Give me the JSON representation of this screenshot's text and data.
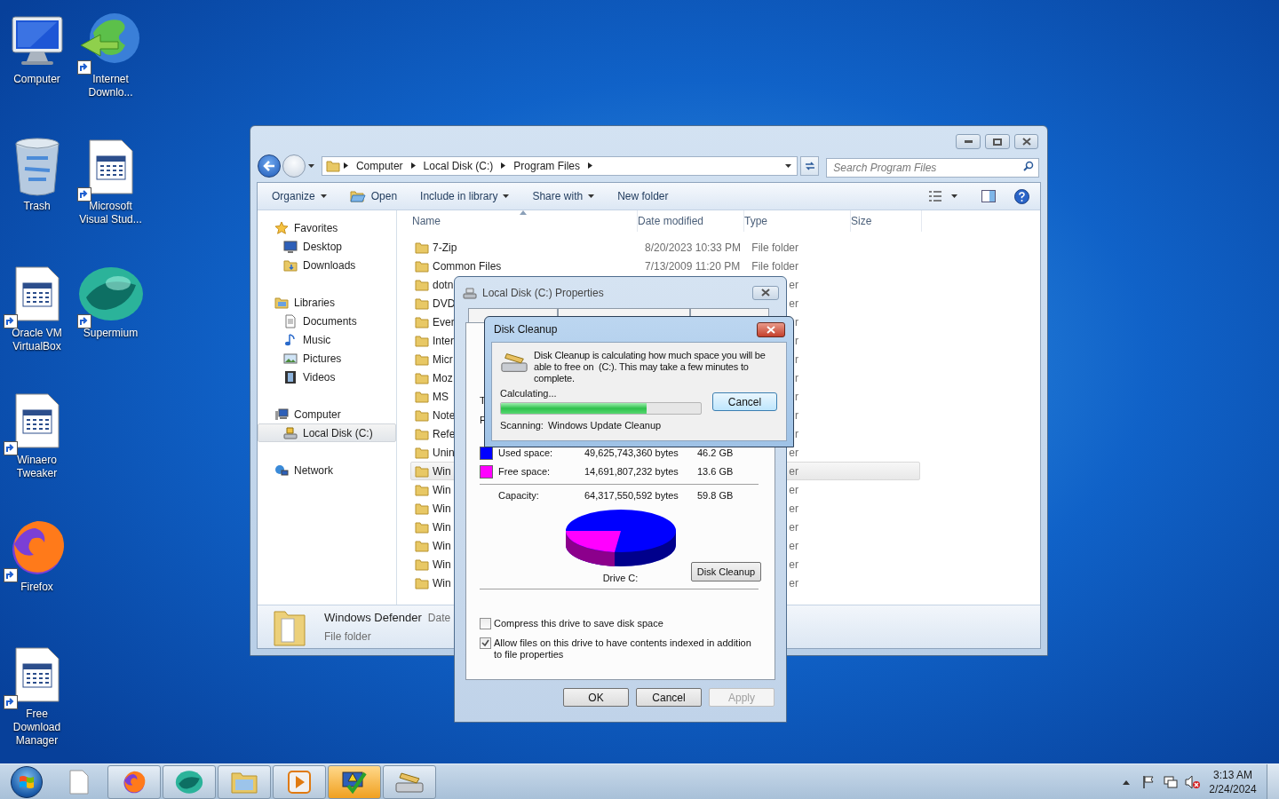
{
  "desktop_icons": [
    {
      "label": "Computer",
      "kind": "monitor",
      "shortcut": false
    },
    {
      "label": "Trash",
      "kind": "bin",
      "shortcut": false
    },
    {
      "label": "Oracle VM VirtualBox",
      "kind": "app",
      "shortcut": true
    },
    {
      "label": "Winaero Tweaker",
      "kind": "app",
      "shortcut": true
    },
    {
      "label": "Firefox",
      "kind": "fox",
      "shortcut": true
    },
    {
      "label": "Free Download Manager",
      "kind": "app",
      "shortcut": true
    },
    {
      "label": "Internet Downlo...",
      "kind": "globe",
      "shortcut": true
    },
    {
      "label": "Microsoft Visual Stud...",
      "kind": "app",
      "shortcut": true
    },
    {
      "label": "Supermium",
      "kind": "orb",
      "shortcut": true
    }
  ],
  "explorer": {
    "breadcrumb": [
      "Computer",
      "Local Disk (C:)",
      "Program Files"
    ],
    "search": {
      "placeholder": "Search Program Files"
    },
    "toolbar": [
      {
        "label": "Organize",
        "kind": "menu"
      },
      {
        "label": "Open",
        "kind": "with-icon"
      },
      {
        "label": "Include in library",
        "kind": "menu"
      },
      {
        "label": "Share with",
        "kind": "menu"
      },
      {
        "label": "New folder",
        "kind": "plain"
      }
    ],
    "nav": [
      {
        "label": "Favorites",
        "kind": "star",
        "selected": false,
        "children": [
          {
            "label": "Desktop",
            "kind": "desktop",
            "selected": false
          },
          {
            "label": "Downloads",
            "kind": "download",
            "selected": false
          }
        ]
      },
      {
        "label": "Libraries",
        "kind": "library",
        "selected": false,
        "children": [
          {
            "label": "Documents",
            "kind": "document",
            "selected": false
          },
          {
            "label": "Music",
            "kind": "music",
            "selected": false
          },
          {
            "label": "Pictures",
            "kind": "pictures",
            "selected": false
          },
          {
            "label": "Videos",
            "kind": "videos",
            "selected": false
          }
        ]
      },
      {
        "label": "Computer",
        "kind": "computer",
        "selected": false,
        "children": [
          {
            "label": "Local Disk (C:)",
            "kind": "disk",
            "selected": true
          }
        ]
      },
      {
        "label": "Network",
        "kind": "network",
        "selected": false
      }
    ],
    "columns": [
      "Name",
      "Date modified",
      "Type",
      "Size"
    ],
    "rows": [
      {
        "name": "7-Zip",
        "date": "8/20/2023 10:33 PM",
        "type": "File folder",
        "selected": false
      },
      {
        "name": "Common Files",
        "date": "7/13/2009 11:20 PM",
        "type": "File folder",
        "selected": false
      },
      {
        "name": "dotn",
        "type": "er",
        "selected": false
      },
      {
        "name": "DVD",
        "type": "er",
        "selected": false
      },
      {
        "name": "Ever",
        "type": "r",
        "selected": false
      },
      {
        "name": "Inter",
        "type": "r",
        "selected": false
      },
      {
        "name": "Micr",
        "type": "r",
        "selected": false
      },
      {
        "name": "Moz",
        "type": "r",
        "selected": false
      },
      {
        "name": "MS",
        "type": "r",
        "selected": false
      },
      {
        "name": "Note",
        "type": "r",
        "selected": false
      },
      {
        "name": "Refe",
        "type": "r",
        "selected": false
      },
      {
        "name": "Unin",
        "type": "er",
        "selected": false
      },
      {
        "name": "Win",
        "type": "er",
        "selected": true
      },
      {
        "name": "Win",
        "type": "er",
        "selected": false
      },
      {
        "name": "Win",
        "type": "er",
        "selected": false
      },
      {
        "name": "Win",
        "type": "er",
        "selected": false
      },
      {
        "name": "Win",
        "type": "er",
        "selected": false
      },
      {
        "name": "Win",
        "type": "er",
        "selected": false
      },
      {
        "name": "Win",
        "type": "er",
        "selected": false
      }
    ],
    "details": {
      "name": "Windows Defender",
      "field": "Date",
      "type": "File folder"
    }
  },
  "properties": {
    "title": "Local Disk (C:) Properties",
    "partial_labels": [
      "T",
      "F"
    ],
    "space": [
      {
        "label": "Used space:",
        "bytes": "49,625,743,360 bytes",
        "size": "46.2 GB",
        "color": "#0000ff"
      },
      {
        "label": "Free space:",
        "bytes": "14,691,807,232 bytes",
        "size": "13.6 GB",
        "color": "#ff00ff"
      }
    ],
    "capacity": {
      "label": "Capacity:",
      "bytes": "64,317,550,592 bytes",
      "size": "59.8 GB"
    },
    "drive_label": "Drive C:",
    "cleanup_button": "Disk Cleanup",
    "options": [
      {
        "label": "Compress this drive to save disk space",
        "checked": false
      },
      {
        "label": "Allow files on this drive to have contents indexed in addition to file properties",
        "checked": true
      }
    ],
    "buttons": [
      {
        "label": "OK",
        "disabled": false
      },
      {
        "label": "Cancel",
        "disabled": false
      },
      {
        "label": "Apply",
        "disabled": true
      }
    ]
  },
  "cleanup": {
    "title": "Disk Cleanup",
    "message": "Disk Cleanup is calculating how much space you will be able to free on  (C:). This may take a few minutes to complete.",
    "status": "Calculating...",
    "level": 0.73,
    "cancel": "Cancel",
    "scanning_label": "Scanning:",
    "scanning_item": "Windows Update Cleanup"
  },
  "taskbar": {
    "items": [
      {
        "kind": "document",
        "running": false,
        "highlighted": false
      },
      {
        "kind": "fox",
        "running": true,
        "highlighted": false
      },
      {
        "kind": "orb",
        "running": true,
        "highlighted": false
      },
      {
        "kind": "explorer",
        "running": true,
        "highlighted": false
      },
      {
        "kind": "media",
        "running": true,
        "highlighted": false
      },
      {
        "kind": "check",
        "running": true,
        "highlighted": true
      },
      {
        "kind": "cleanup",
        "running": true,
        "highlighted": false
      }
    ],
    "tray": [
      {
        "kind": "up"
      },
      {
        "kind": "flag"
      },
      {
        "kind": "network"
      },
      {
        "kind": "muted"
      }
    ],
    "time": "3:13 AM",
    "date": "2/24/2024"
  }
}
